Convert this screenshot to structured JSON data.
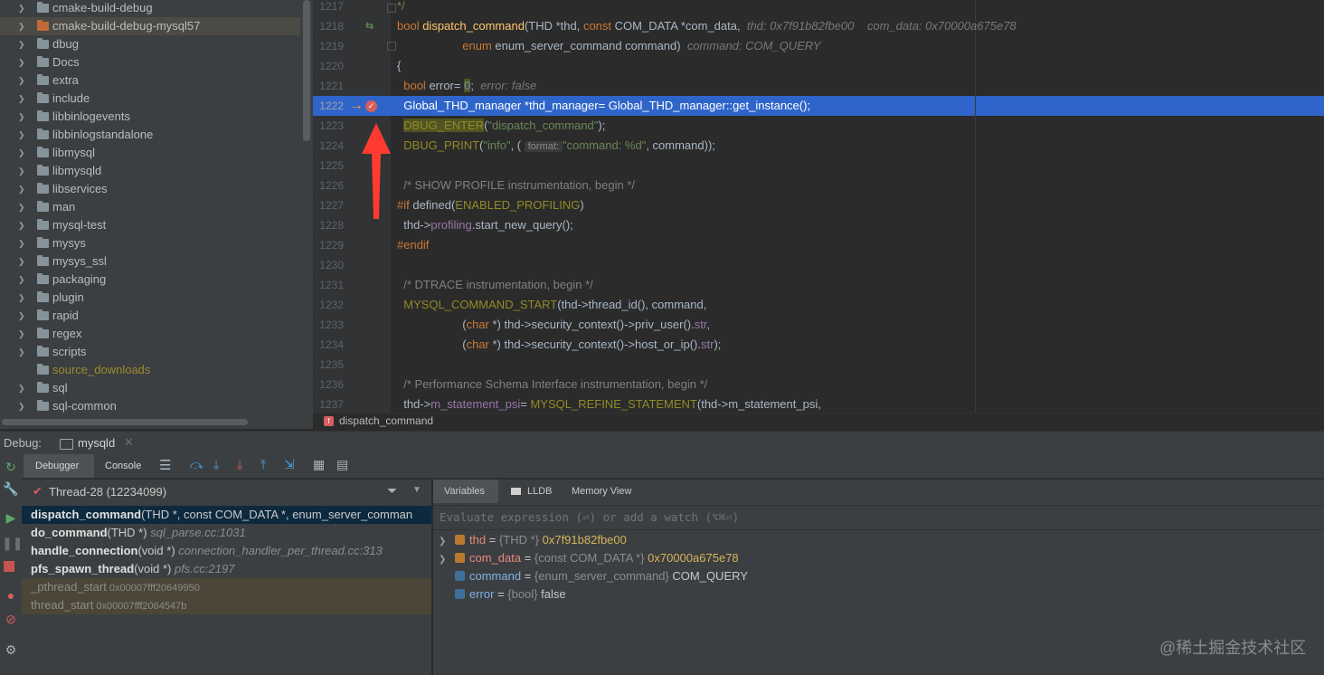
{
  "tree": {
    "items": [
      {
        "label": "cmake-build-debug",
        "expandable": true,
        "color": "normal"
      },
      {
        "label": "cmake-build-debug-mysql57",
        "expandable": true,
        "color": "normal",
        "selected": true,
        "folder": "orange"
      },
      {
        "label": "dbug",
        "expandable": true,
        "color": "normal"
      },
      {
        "label": "Docs",
        "expandable": true,
        "color": "normal"
      },
      {
        "label": "extra",
        "expandable": true,
        "color": "normal"
      },
      {
        "label": "include",
        "expandable": true,
        "color": "normal"
      },
      {
        "label": "libbinlogevents",
        "expandable": true,
        "color": "normal"
      },
      {
        "label": "libbinlogstandalone",
        "expandable": true,
        "color": "normal"
      },
      {
        "label": "libmysql",
        "expandable": true,
        "color": "normal"
      },
      {
        "label": "libmysqld",
        "expandable": true,
        "color": "normal"
      },
      {
        "label": "libservices",
        "expandable": true,
        "color": "normal"
      },
      {
        "label": "man",
        "expandable": true,
        "color": "normal"
      },
      {
        "label": "mysql-test",
        "expandable": true,
        "color": "normal"
      },
      {
        "label": "mysys",
        "expandable": true,
        "color": "normal"
      },
      {
        "label": "mysys_ssl",
        "expandable": true,
        "color": "normal"
      },
      {
        "label": "packaging",
        "expandable": true,
        "color": "normal"
      },
      {
        "label": "plugin",
        "expandable": true,
        "color": "normal"
      },
      {
        "label": "rapid",
        "expandable": true,
        "color": "normal"
      },
      {
        "label": "regex",
        "expandable": true,
        "color": "normal"
      },
      {
        "label": "scripts",
        "expandable": true,
        "color": "normal"
      },
      {
        "label": "source_downloads",
        "expandable": false,
        "color": "gold"
      },
      {
        "label": "sql",
        "expandable": true,
        "color": "normal"
      },
      {
        "label": "sql-common",
        "expandable": true,
        "color": "normal"
      }
    ]
  },
  "editor": {
    "line_numbers": [
      "1217",
      "1218",
      "1219",
      "1220",
      "1221",
      "1222",
      "1223",
      "1224",
      "1225",
      "1226",
      "1227",
      "1228",
      "1229",
      "1230",
      "1231",
      "1232",
      "1233",
      "1234",
      "1235",
      "1236",
      "1237"
    ],
    "current_line": "1222",
    "l1217": "*/",
    "l1218_kw": "bool ",
    "l1218_fn": "dispatch_command",
    "l1218_rest": "(THD *thd, ",
    "l1218_kw2": "const ",
    "l1218_rest2": "COM_DATA *com_data,",
    "l1218_hint1": "thd: 0x7f91b82fbe00",
    "l1218_hint2": "com_data: 0x70000a675e78",
    "l1219_kw": "enum ",
    "l1219_rest": "enum_server_command command)",
    "l1219_hint": "command: COM_QUERY",
    "l1220": "{",
    "l1221_kw": "bool ",
    "l1221_rest": "error= ",
    "l1221_num": "0",
    "l1221_semi": ";",
    "l1221_hint": "error: false",
    "l1222": "Global_THD_manager *thd_manager= Global_THD_manager::get_instance();",
    "l1223_macro": "DBUG_ENTER",
    "l1223_open": "(",
    "l1223_str": "\"dispatch_command\"",
    "l1223_close": ");",
    "l1224_macro": "DBUG_PRINT",
    "l1224_open": "(",
    "l1224_str1": "\"info\"",
    "l1224_mid": ", ( ",
    "l1224_inlay": "format:",
    "l1224_str2": "\"command: %d\"",
    "l1224_close": ", command));",
    "l1226": "/* SHOW PROFILE instrumentation, begin */",
    "l1227_kw": "#if ",
    "l1227_rest": "defined(",
    "l1227_macro": "ENABLED_PROFILING",
    "l1227_close": ")",
    "l1228_a": "thd->",
    "l1228_field": "profiling",
    "l1228_b": ".start_new_query();",
    "l1229": "#endif",
    "l1231": "/* DTRACE instrumentation, begin */",
    "l1232_macro": "MYSQL_COMMAND_START",
    "l1232_rest": "(thd->thread_id(), command,",
    "l1233_open": "(",
    "l1233_kw": "char ",
    "l1233_rest": "*) thd->security_context()->priv_user().",
    "l1233_field": "str",
    "l1233_end": ",",
    "l1234_open": "(",
    "l1234_kw": "char ",
    "l1234_rest": "*) thd->security_context()->host_or_ip().",
    "l1234_field": "str",
    "l1234_end": ");",
    "l1236": "/* Performance Schema Interface instrumentation, begin */",
    "l1237_a": "thd->",
    "l1237_field": "m_statement_psi",
    "l1237_b": "= ",
    "l1237_macro": "MYSQL_REFINE_STATEMENT",
    "l1237_c": "(thd->m_statement_psi,",
    "breadcrumb": "dispatch_command"
  },
  "debug": {
    "title": "Debug:",
    "config": "mysqld",
    "tabs": [
      "Debugger",
      "Console"
    ],
    "thread": "Thread-28 (12234099)",
    "frames": [
      {
        "fn": "dispatch_command",
        "args": "(THD *, const COM_DATA *, enum_server_comman",
        "loc": "",
        "type": "sel"
      },
      {
        "fn": "do_command",
        "args": "(THD *)",
        "loc": "sql_parse.cc:1031",
        "type": "normal"
      },
      {
        "fn": "handle_connection",
        "args": "(void *)",
        "loc": "connection_handler_per_thread.cc:313",
        "type": "normal"
      },
      {
        "fn": "pfs_spawn_thread",
        "args": "(void *)",
        "loc": "pfs.cc:2197",
        "type": "normal"
      },
      {
        "fn": "_pthread_start",
        "args": " 0x00007fff20649950",
        "loc": "",
        "type": "lib"
      },
      {
        "fn": "thread_start",
        "args": " 0x00007fff2064547b",
        "loc": "",
        "type": "lib"
      }
    ],
    "var_tabs": [
      "Variables",
      "LLDB",
      "Memory View"
    ],
    "eval_placeholder": "Evaluate expression (⏎) or add a watch (⌥⌘⏎)",
    "variables": [
      {
        "name": "thd",
        "type": "{THD *}",
        "value": "0x7f91b82fbe00",
        "expandable": true,
        "kind": "struct"
      },
      {
        "name": "com_data",
        "type": "{const COM_DATA *}",
        "value": "0x70000a675e78",
        "expandable": true,
        "kind": "struct"
      },
      {
        "name": "command",
        "type": "{enum_server_command}",
        "value": "COM_QUERY",
        "expandable": false,
        "kind": "prim"
      },
      {
        "name": "error",
        "type": "{bool}",
        "value": "false",
        "expandable": false,
        "kind": "prim"
      }
    ]
  },
  "watermark": "@稀土掘金技术社区",
  "colors": {
    "accent": "#2f65ca",
    "arrow": "#ff3b2f",
    "breakpoint": "#d75e5e"
  }
}
